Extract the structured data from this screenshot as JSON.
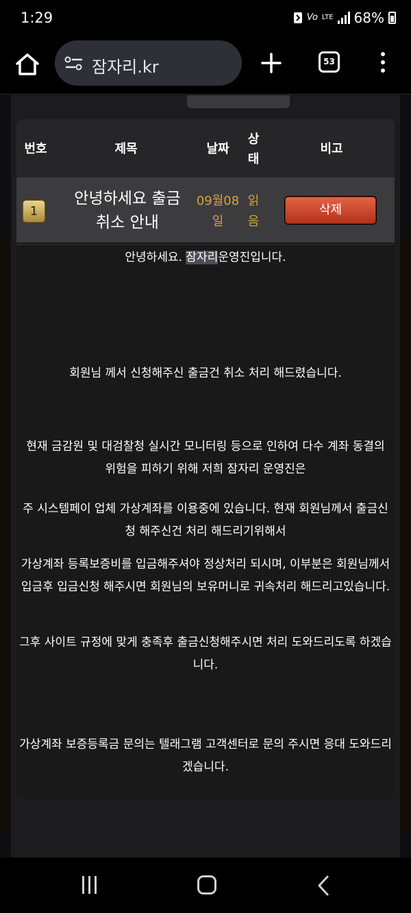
{
  "status_bar": {
    "time": "1:29",
    "network_top": "Vo",
    "network_label": "LTE",
    "battery": "68%"
  },
  "browser": {
    "url": "잠자리.kr",
    "tab_count": "53",
    "icons": [
      "home-icon",
      "site-settings-icon",
      "plus-icon",
      "tabs-icon",
      "more-vert-icon"
    ]
  },
  "board": {
    "headers": {
      "number": "번호",
      "title": "제목",
      "date": "날짜",
      "status_line1": "상",
      "status_line2": "태",
      "note": "비고"
    },
    "row": {
      "number": "1",
      "title": "안녕하세요 출금 취소 안내",
      "date": "09월08일",
      "status": "읽음",
      "delete_label": "삭제"
    }
  },
  "message": {
    "greeting_pre": "안녕하세요. ",
    "greeting_highlight": "잠자리",
    "greeting_post": "운영진입니다.",
    "p1": "회원님 께서 신청해주신 출금건 취소 처리 해드렸습니다.",
    "p2": "현재 금감원 및 대검찰청 실시간 모니터링 등으로 인하여 다수 계좌 동결의 위험을 피하기 위해 저희 잠자리 운영진은",
    "p3": "주 시스템페이 업체 가상계좌를 이용중에 있습니다. 현재 회원님께서 출금신청 해주신건 처리 해드리기위해서",
    "p4": "가상계좌 등록보증비를 입금해주셔야 정상처리 되시며, 이부분은 회원님께서 입금후 입금신청 해주시면 회원님의 보유머니로 귀속처리 해드리고있습니다.",
    "p5": "그후 사이트 규정에 맞게 충족후 출금신청해주시면 처리 도와드리도록 하겠습니다.",
    "p6": "가상계좌 보증등록금 문의는 텔래그램 고객센터로 문의 주시면 응대 도와드리겠습니다."
  },
  "navbar": {
    "icons": [
      "recents-icon",
      "home-nav-icon",
      "back-icon"
    ]
  }
}
